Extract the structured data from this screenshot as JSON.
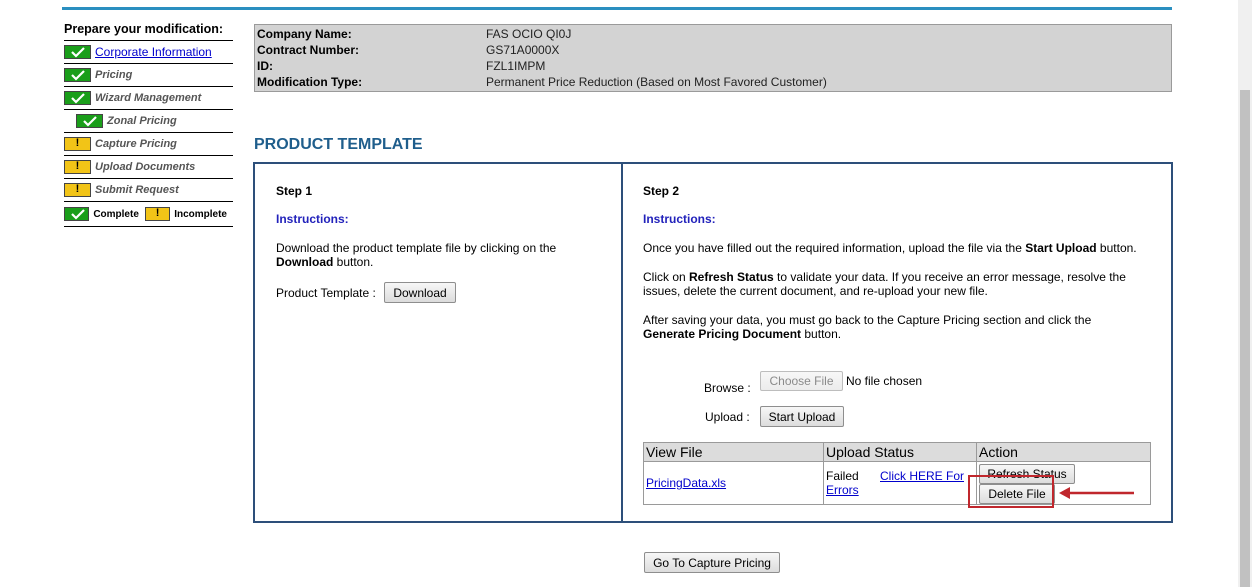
{
  "sidebar": {
    "title": "Prepare your modification:",
    "items": [
      {
        "label": "Corporate Information",
        "status": "complete",
        "link": true
      },
      {
        "label": "Pricing",
        "status": "complete"
      },
      {
        "label": "Wizard Management",
        "status": "complete"
      },
      {
        "label": "Zonal Pricing",
        "status": "complete",
        "indent": true
      },
      {
        "label": "Capture Pricing",
        "status": "incomplete"
      },
      {
        "label": "Upload Documents",
        "status": "incomplete"
      },
      {
        "label": "Submit Request",
        "status": "incomplete"
      }
    ],
    "legend": {
      "complete": "Complete",
      "incomplete": "Incomplete"
    },
    "incomplete_mark": "!"
  },
  "info": {
    "company_name_label": "Company Name:",
    "company_name": "FAS OCIO QI0J",
    "contract_number_label": "Contract Number:",
    "contract_number": "GS71A0000X",
    "id_label": "ID:",
    "id": "FZL1IMPM",
    "mod_type_label": "Modification Type:",
    "mod_type": "Permanent Price Reduction (Based on Most Favored Customer)"
  },
  "section_title": "PRODUCT TEMPLATE",
  "step1": {
    "title": "Step 1",
    "instructions_label": "Instructions:",
    "text_a": "Download the product template file by clicking on the",
    "text_b_bold": "Download",
    "text_b_rest": " button.",
    "template_label": "Product Template :",
    "download_button": "Download"
  },
  "step2": {
    "title": "Step 2",
    "instructions_label": "Instructions:",
    "p1_a": "Once you have filled out the required information, upload the file via the ",
    "p1_bold": "Start Upload",
    "p1_b": " button.",
    "p2_a": "Click on ",
    "p2_bold": "Refresh Status",
    "p2_b": " to validate your data. If you receive an error message, resolve the issues, delete the current document, and re-upload your new file.",
    "p3_a": "After saving your data, you must go back to the Capture Pricing section and click the ",
    "p3_bold": "Generate Pricing Document",
    "p3_b": " button.",
    "browse_label": "Browse :",
    "choose_file_button": "Choose File",
    "no_file_text": "No file chosen",
    "upload_label": "Upload :",
    "start_upload_button": "Start Upload",
    "table": {
      "headers": [
        "View File",
        "Upload Status",
        "Action"
      ],
      "row": {
        "file": "PricingData.xls",
        "status": "Failed",
        "errors_link": "Click HERE For Errors",
        "refresh_button": "Refresh Status",
        "delete_button": "Delete File"
      }
    }
  },
  "goto_button": "Go To Capture Pricing",
  "colors": {
    "accent": "#1f5e8c",
    "complete": "#1a9e1a",
    "incomplete": "#f2c417",
    "highlight": "#c0272d"
  }
}
